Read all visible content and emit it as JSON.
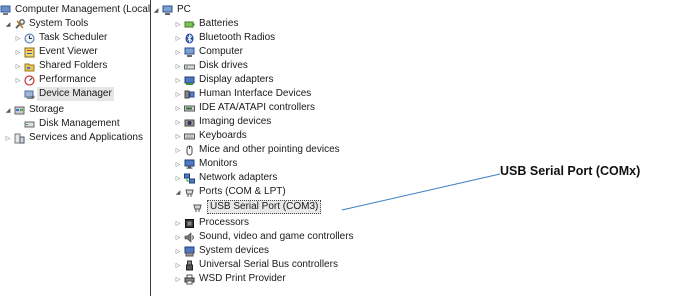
{
  "left_tree": {
    "root": "Computer Management (Local",
    "system_tools": "System Tools",
    "task_scheduler": "Task Scheduler",
    "event_viewer": "Event Viewer",
    "shared_folders": "Shared Folders",
    "performance": "Performance",
    "device_manager": "Device Manager",
    "storage": "Storage",
    "disk_management": "Disk Management",
    "services_apps": "Services and Applications"
  },
  "device_tree": {
    "root": "PC",
    "categories": [
      {
        "label": "Batteries",
        "icon": "battery-icon"
      },
      {
        "label": "Bluetooth Radios",
        "icon": "bluetooth-icon"
      },
      {
        "label": "Computer",
        "icon": "computer-icon"
      },
      {
        "label": "Disk drives",
        "icon": "disk-drive-icon"
      },
      {
        "label": "Display adapters",
        "icon": "display-adapter-icon"
      },
      {
        "label": "Human Interface Devices",
        "icon": "hid-icon"
      },
      {
        "label": "IDE ATA/ATAPI controllers",
        "icon": "ide-controller-icon"
      },
      {
        "label": "Imaging devices",
        "icon": "camera-icon"
      },
      {
        "label": "Keyboards",
        "icon": "keyboard-icon"
      },
      {
        "label": "Mice and other pointing devices",
        "icon": "mouse-icon"
      },
      {
        "label": "Monitors",
        "icon": "monitor-icon"
      },
      {
        "label": "Network adapters",
        "icon": "network-icon"
      },
      {
        "label": "Ports (COM & LPT)",
        "icon": "port-icon"
      },
      {
        "label": "USB Serial Port (COM3)",
        "icon": "port-icon"
      },
      {
        "label": "Processors",
        "icon": "processor-icon"
      },
      {
        "label": "Sound, video and game controllers",
        "icon": "sound-icon"
      },
      {
        "label": "System devices",
        "icon": "system-device-icon"
      },
      {
        "label": "Universal Serial Bus controllers",
        "icon": "usb-icon"
      },
      {
        "label": "WSD Print Provider",
        "icon": "printer-icon"
      }
    ]
  },
  "annotation": {
    "text": "USB Serial Port (COMx)"
  }
}
